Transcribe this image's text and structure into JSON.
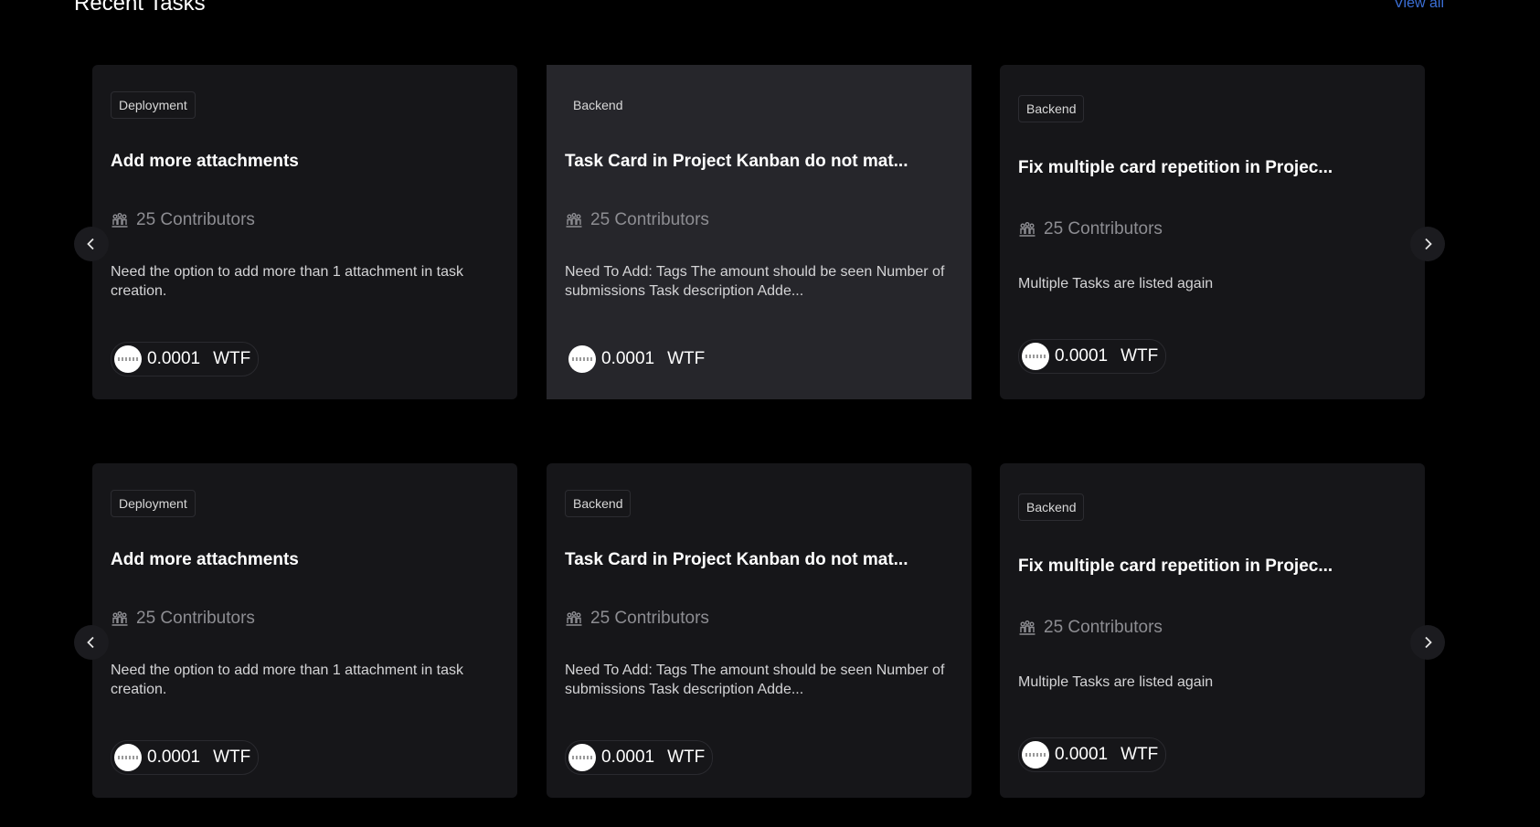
{
  "header": {
    "title": "Recent Tasks",
    "view_all": "View all"
  },
  "rows": [
    {
      "cards": [
        {
          "tag": "Deployment",
          "title": "Add more attachments",
          "contributors": "25 Contributors",
          "description": "Need the option to add more than 1 attachment in task creation.",
          "amount": "0.0001",
          "unit": "WTF"
        },
        {
          "tag": "Backend",
          "title": "Task Card in Project Kanban do not mat...",
          "contributors": "25 Contributors",
          "description": "Need To Add: Tags The amount should be seen Number of submissions Task description Adde...",
          "amount": "0.0001",
          "unit": "WTF"
        },
        {
          "tag": "Backend",
          "title": "Fix multiple card repetition in Projec...",
          "contributors": "25 Contributors",
          "description": "Multiple Tasks are listed again",
          "amount": "0.0001",
          "unit": "WTF"
        }
      ]
    },
    {
      "cards": [
        {
          "tag": "Deployment",
          "title": "Add more attachments",
          "contributors": "25 Contributors",
          "description": "Need the option to add more than 1 attachment in task creation.",
          "amount": "0.0001",
          "unit": "WTF"
        },
        {
          "tag": "Backend",
          "title": "Task Card in Project Kanban do not mat...",
          "contributors": "25 Contributors",
          "description": "Need To Add: Tags The amount should be seen Number of submissions Task description Adde...",
          "amount": "0.0001",
          "unit": "WTF"
        },
        {
          "tag": "Backend",
          "title": "Fix multiple card repetition in Projec...",
          "contributors": "25 Contributors",
          "description": "Multiple Tasks are listed again",
          "amount": "0.0001",
          "unit": "WTF"
        }
      ]
    }
  ],
  "colors": {
    "background": "#000000",
    "card": "#161619",
    "card_hover": "#26262b",
    "link": "#3b6fd6"
  },
  "icons": {
    "contributors": "people-group-icon",
    "prev": "chevron-left-icon",
    "next": "chevron-right-icon",
    "token": "coin-icon"
  }
}
